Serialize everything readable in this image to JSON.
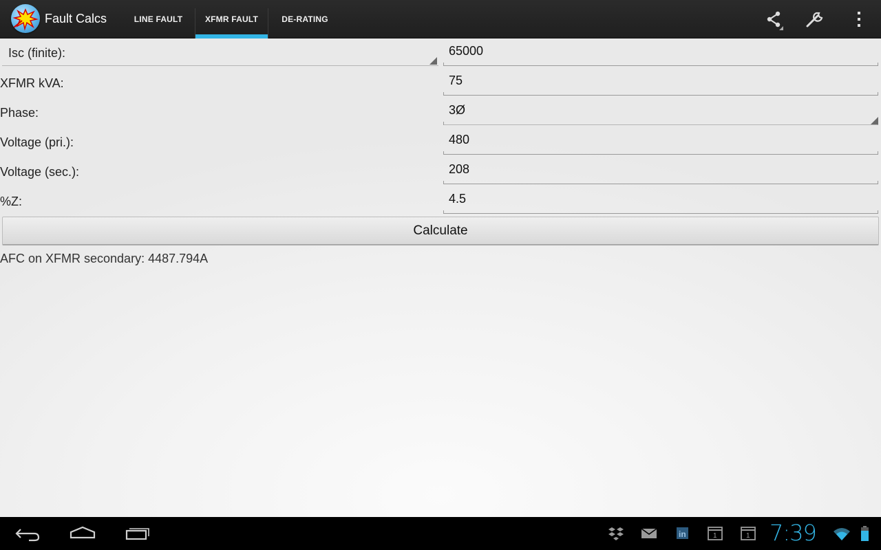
{
  "app": {
    "title": "Fault Calcs",
    "accent_color": "#33b5e5"
  },
  "tabs": [
    {
      "label": "LINE FAULT",
      "selected": false
    },
    {
      "label": "XFMR FAULT",
      "selected": true
    },
    {
      "label": "DE-RATING",
      "selected": false
    }
  ],
  "actions": {
    "icons": [
      "share-icon",
      "wrench-icon",
      "overflow-menu-icon"
    ]
  },
  "form": {
    "isc_spinner_label": "Isc (finite):",
    "isc_value": "65000",
    "kva_label": "XFMR kVA:",
    "kva_value": "75",
    "phase_label": "Phase:",
    "phase_value": "3Ø",
    "vpri_label": "Voltage (pri.):",
    "vpri_value": "480",
    "vsec_label": "Voltage (sec.):",
    "vsec_value": "208",
    "z_label": "%Z:",
    "z_value": "4.5",
    "calculate_label": "Calculate",
    "result_text": "AFC on XFMR secondary: 4487.794A"
  },
  "system_bar": {
    "nav_icons": [
      "back-icon",
      "home-icon",
      "recent-apps-icon"
    ],
    "notification_icons": [
      "dropbox-icon",
      "mail-icon",
      "linkedin-icon",
      "calendar-icon",
      "calendar-icon"
    ],
    "calendar_day": "1",
    "linkedin_text": "in",
    "time": "7:39"
  }
}
